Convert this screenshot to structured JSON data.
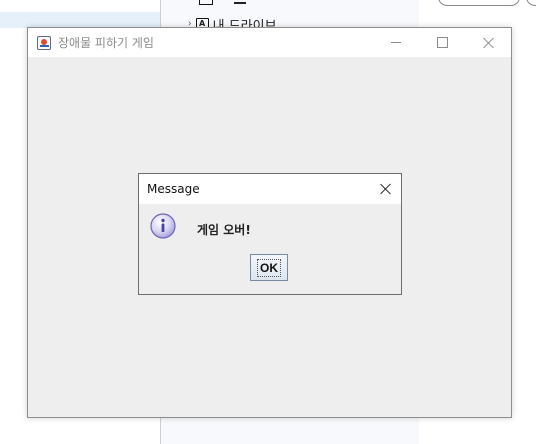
{
  "background": {
    "drive_label": "내 드라이브"
  },
  "window": {
    "title": "장애물 피하기 게임",
    "icon": "java-app-icon",
    "controls": [
      "minimize-icon",
      "maximize-icon",
      "close-icon"
    ]
  },
  "dialog": {
    "title": "Message",
    "icon": "info-icon",
    "message": "게임 오버!",
    "ok_label": "OK"
  }
}
